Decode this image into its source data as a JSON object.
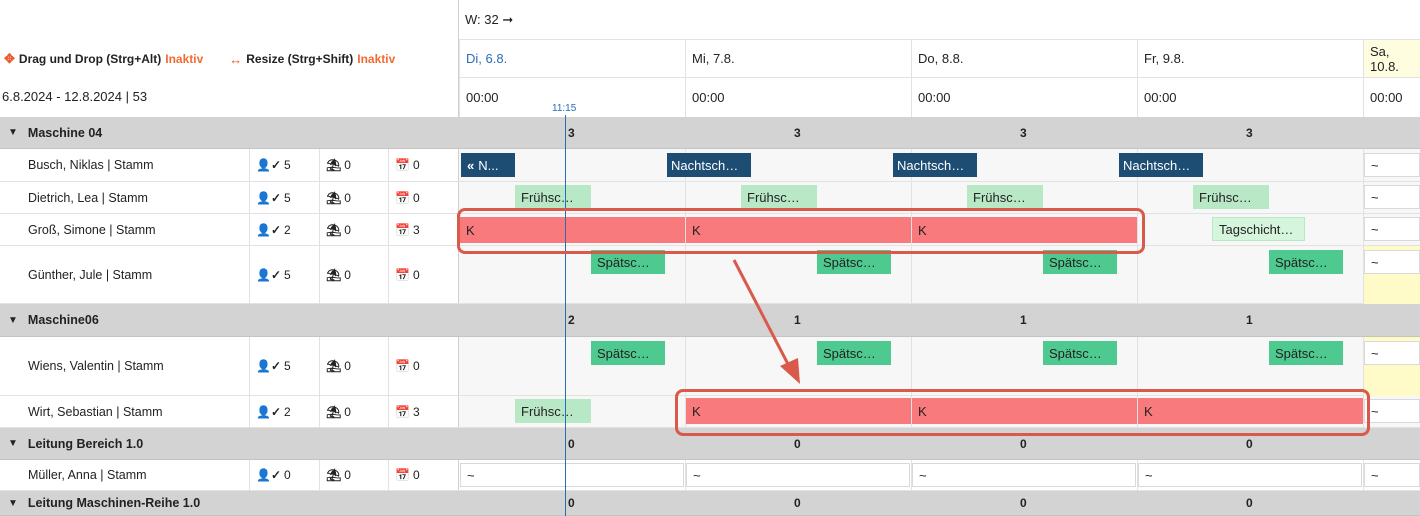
{
  "toolbar": {
    "dragdrop_label": "Drag und Drop (Strg+Alt)",
    "dragdrop_state": "Inaktiv",
    "resize_label": "Resize (Strg+Shift)",
    "resize_state": "Inaktiv",
    "date_range": "6.8.2024 - 12.8.2024 | 53"
  },
  "week": {
    "label": "W: 32 ➞"
  },
  "days": [
    {
      "label": "Di, 6.8.",
      "time": "00:00"
    },
    {
      "label": "Mi, 7.8.",
      "time": "00:00"
    },
    {
      "label": "Do, 8.8.",
      "time": "00:00"
    },
    {
      "label": "Fr, 9.8.",
      "time": "00:00"
    },
    {
      "label": "Sa, 10.8.",
      "time": "00:00"
    }
  ],
  "now": "11:15",
  "groups": [
    {
      "name": "Maschine 04",
      "counts": [
        "3",
        "3",
        "3",
        "3"
      ]
    },
    {
      "name": "Maschine06",
      "counts": [
        "2",
        "1",
        "1",
        "1"
      ]
    },
    {
      "name": "Leitung Bereich 1.0",
      "counts": [
        "0",
        "0",
        "0",
        "0"
      ]
    },
    {
      "name": "Leitung Maschinen-Reihe 1.0",
      "counts": [
        "0",
        "0",
        "0",
        "0"
      ]
    }
  ],
  "employees": [
    {
      "name": "Busch, Niklas | Stamm",
      "a": "5",
      "b": "0",
      "c": "0"
    },
    {
      "name": "Dietrich, Lea | Stamm",
      "a": "5",
      "b": "0",
      "c": "0"
    },
    {
      "name": "Groß, Simone | Stamm",
      "a": "2",
      "b": "0",
      "c": "3"
    },
    {
      "name": "Günther, Jule | Stamm",
      "a": "5",
      "b": "0",
      "c": "0"
    },
    {
      "name": "Wiens, Valentin | Stamm",
      "a": "5",
      "b": "0",
      "c": "0"
    },
    {
      "name": "Wirt, Sebastian | Stamm",
      "a": "2",
      "b": "0",
      "c": "3"
    },
    {
      "name": "Müller, Anna | Stamm",
      "a": "0",
      "b": "0",
      "c": "0"
    }
  ],
  "shifts": {
    "nacht_first": "N...",
    "nacht": "Nachtsch…",
    "frueh": "Frühsc…",
    "spaet": "Spätsc…",
    "tag": "Tagschicht…",
    "krank": "K",
    "empty": "~",
    "collapse": "«"
  },
  "colors": {
    "nacht": "#1e4d74",
    "frueh": "#b9e8c6",
    "spaet": "#4ec98f",
    "krank": "#f87a7c",
    "highlight": "#d9594a",
    "inaktiv": "#f26b2e"
  }
}
